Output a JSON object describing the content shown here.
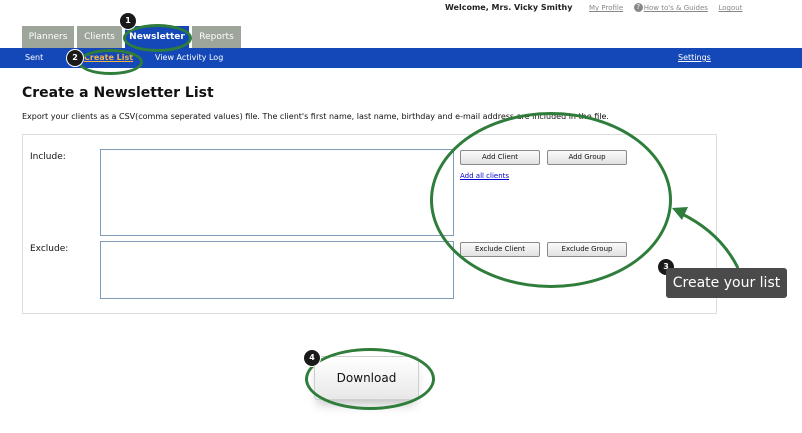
{
  "header": {
    "welcome": "Welcome, Mrs. Vicky Smithy",
    "my_profile": "My Profile",
    "help_icon": "help-icon",
    "guides": "How to's & Guides",
    "logout": "Logout"
  },
  "tabs": [
    {
      "label": "Planners"
    },
    {
      "label": "Clients"
    },
    {
      "label": "Newsletter"
    },
    {
      "label": "Reports"
    }
  ],
  "active_tab": "Newsletter",
  "subnav": {
    "sent": "Sent",
    "create_list": "Create List",
    "view_activity_log": "View Activity Log",
    "settings": "Settings"
  },
  "page": {
    "title": "Create a Newsletter List",
    "description": "Export your clients as a CSV(comma seperated values) file. The client's first name, last name, birthday and e-mail address are included in the file."
  },
  "form": {
    "include_label": "Include:",
    "exclude_label": "Exclude:",
    "add_client": "Add Client",
    "add_group": "Add Group",
    "add_all_clients": "Add all clients",
    "exclude_client": "Exclude Client",
    "exclude_group": "Exclude Group"
  },
  "download_label": "Download",
  "annotations": {
    "steps": [
      "1",
      "2",
      "3",
      "4"
    ],
    "tooltip": "Create your list",
    "color": "#2e7d3a"
  },
  "colors": {
    "nav_blue": "#1448b8",
    "tab_gray": "#9ea59a",
    "active_subnav": "#f0b24a"
  }
}
